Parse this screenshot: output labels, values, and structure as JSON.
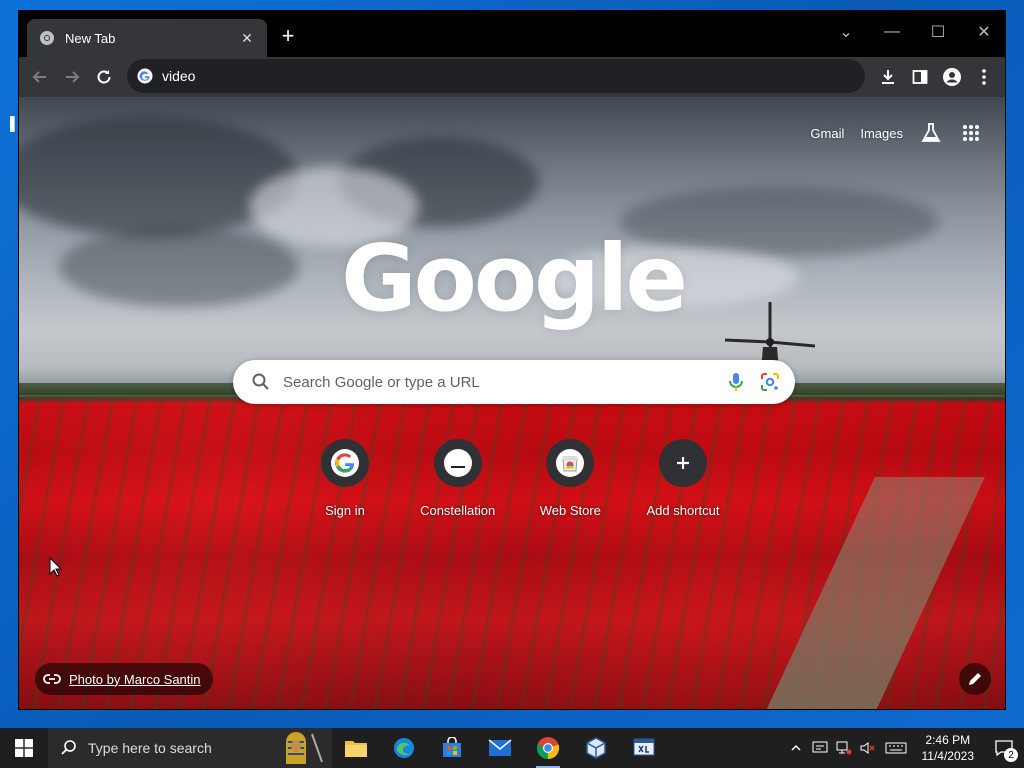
{
  "browser": {
    "tab_title": "New Tab",
    "address_value": "video",
    "colors": {
      "tabstrip": "#000000",
      "toolbar": "#35363a",
      "omnibox": "#202124"
    }
  },
  "ntp": {
    "top_links": {
      "gmail": "Gmail",
      "images": "Images"
    },
    "logo": "Google",
    "search_placeholder": "Search Google or type a URL",
    "shortcuts": [
      {
        "label": "Sign in",
        "icon": "google-g-icon"
      },
      {
        "label": "Constellation",
        "icon": "constellation-icon"
      },
      {
        "label": "Web Store",
        "icon": "web-store-icon"
      },
      {
        "label": "Add shortcut",
        "icon": "plus-icon"
      }
    ],
    "photo_credit": "Photo by Marco Santin"
  },
  "taskbar": {
    "search_placeholder": "Type here to search",
    "apps": [
      "file-explorer-icon",
      "edge-icon",
      "store-icon",
      "mail-icon",
      "chrome-icon",
      "virtualbox-icon",
      "app-xp-icon"
    ],
    "time": "2:46 PM",
    "date": "11/4/2023",
    "notification_count": "2"
  }
}
